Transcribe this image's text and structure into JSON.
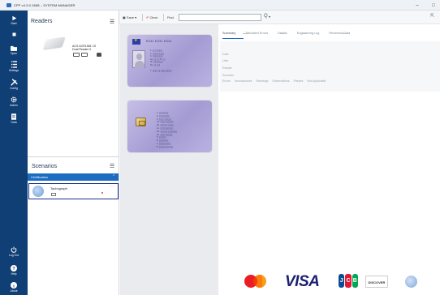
{
  "window": {
    "title": "CPF v4.3.0.1658 – SYSTEM MANAGER",
    "minimize": "–",
    "maximize": "□"
  },
  "nav": {
    "top": [
      {
        "label": "Start",
        "icon": "play-icon"
      },
      {
        "label": "",
        "icon": "stop-icon"
      },
      {
        "label": "Open",
        "icon": "folder-icon"
      },
      {
        "label": "Settings",
        "icon": "list-icon"
      },
      {
        "label": "Config",
        "icon": "tools-icon"
      },
      {
        "label": "Admin",
        "icon": "gear-icon"
      },
      {
        "label": "Tools",
        "icon": "document-icon"
      }
    ],
    "bottom": [
      {
        "label": "Log Out",
        "icon": "power-icon"
      },
      {
        "label": "Help",
        "icon": "help-icon"
      },
      {
        "label": "About",
        "icon": "info-icon"
      }
    ]
  },
  "readers": {
    "title": "Readers",
    "menu": "☰",
    "items": [
      {
        "name_line1": "ACS ACR1581 1S",
        "name_line2": "Dual Reader 0",
        "more": "···"
      }
    ]
  },
  "scenarios": {
    "title": "Scenarios",
    "menu": "☰",
    "category": "Certification",
    "category_chevron": "⌃",
    "items": [
      {
        "name": "Tachograph",
        "more": "···"
      }
    ]
  },
  "toolbar": {
    "save_label": "Save",
    "clear_label": "Clear",
    "find_label": "Find",
    "find_value": "",
    "search_glyph": "Q",
    "export_glyph": "⇱"
  },
  "card_front": {
    "title": "EZ31 EZ31 EZ31",
    "lines": [
      "1.  ▯▯  ▯▯▯▯▯▯",
      "2.  ▯▯▯▯▯▯▯▯▯▯",
      "3.  ▯▯▯▯▯▯▯▯▯",
      "4a. ▯▯  ▯▯   4c. ▯▯",
      "4b. ▯▯▯▯▯▯▯▯",
      "5a. ▯▯  ▯▯▯",
      "",
      "7.  ▯▯▯▯ ▯▯ ▯▯▯▯ ▯▯▯▯▯"
    ]
  },
  "card_back": {
    "lines": [
      "1.  ▯▯▯▯▯▯▯▯",
      "2.  ▯▯▯▯▯▯▯▯▯",
      "3.  ▯▯▯▯ ▯▯▯▯▯▯",
      "4a. ▯▯▯▯▯ ▯▯▯▯▯▯",
      "4b. ▯▯▯▯▯▯ ▯▯▯▯▯",
      "4c. ▯▯▯▯▯▯▯▯▯▯▯",
      "4d. ▯▯▯▯▯▯ ▯▯▯▯▯▯▯▯",
      "4e. ▯▯▯▯ ▯▯▯▯▯▯",
      "5.  ▯▯▯▯▯▯",
      "6.  ▯▯▯▯▯▯▯▯",
      "7.  ▯▯▯▯▯▯▯▯▯▯",
      "8.  ▯▯▯▯▯▯▯▯▯▯▯▯"
    ]
  },
  "tabs": [
    {
      "label": "Summary",
      "active": true
    },
    {
      "label": "Tabulated Errors",
      "active": false
    },
    {
      "label": "Details",
      "active": false
    },
    {
      "label": "Engineering Log",
      "active": false
    },
    {
      "label": "Reviewed Data",
      "active": false
    }
  ],
  "summary": {
    "fields": [
      "Date",
      "User",
      "Reader",
      "Scenario"
    ],
    "counts": [
      "Errors",
      "Inconclusives",
      "Warnings",
      "Observations",
      "Passes",
      "Not Applicable"
    ]
  },
  "payment": {
    "visa": "VISA",
    "jcb": [
      "J",
      "C",
      "B"
    ],
    "discover": "DISCOVER"
  },
  "colors": {
    "sidebar": "#0f3f74",
    "accent": "#1c6cc4",
    "card": "#a49bd3"
  }
}
